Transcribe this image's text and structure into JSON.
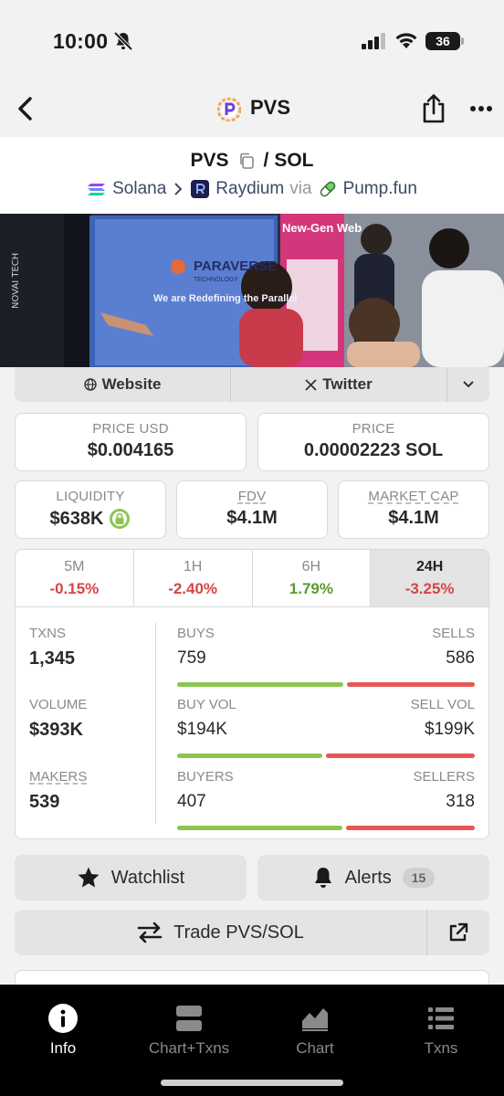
{
  "status_bar": {
    "time": "10:00",
    "battery": "36"
  },
  "nav": {
    "title": "PVS"
  },
  "pair": {
    "base": "PVS",
    "separator": "/",
    "quote": "SOL",
    "chain": "Solana",
    "dex": "Raydium",
    "via": "via",
    "launchpad": "Pump.fun"
  },
  "banner": {
    "brand": "PARAVERSE",
    "brand_sub": "TECHNOLOGY",
    "tagline": "We are Redefining the Parallel",
    "poster_title": "New-Gen Web",
    "side_text": "NOVAI TECH"
  },
  "links": {
    "website": "Website",
    "twitter": "Twitter"
  },
  "prices": {
    "usd_label": "PRICE USD",
    "usd_value": "$0.004165",
    "native_label": "PRICE",
    "native_value": "0.00002223 SOL"
  },
  "metrics": {
    "liquidity_label": "LIQUIDITY",
    "liquidity_value": "$638K",
    "fdv_label": "FDV",
    "fdv_value": "$4.1M",
    "mcap_label": "MARKET CAP",
    "mcap_value": "$4.1M"
  },
  "timeframes": [
    {
      "label": "5M",
      "change": "-0.15%"
    },
    {
      "label": "1H",
      "change": "-2.40%"
    },
    {
      "label": "6H",
      "change": "1.79%"
    },
    {
      "label": "24H",
      "change": "-3.25%"
    }
  ],
  "stats": {
    "txns_label": "TXNS",
    "txns_value": "1,345",
    "volume_label": "VOLUME",
    "volume_value": "$393K",
    "makers_label": "MAKERS",
    "makers_value": "539",
    "buys_label": "BUYS",
    "buys_value": "759",
    "sells_label": "SELLS",
    "sells_value": "586",
    "buys_fraction": 0.564,
    "buyvol_label": "BUY VOL",
    "buyvol_value": "$194K",
    "sellvol_label": "SELL VOL",
    "sellvol_value": "$199K",
    "buyvol_fraction": 0.494,
    "buyers_label": "BUYERS",
    "buyers_value": "407",
    "sellers_label": "SELLERS",
    "sellers_value": "318",
    "buyers_fraction": 0.561
  },
  "actions": {
    "watchlist": "Watchlist",
    "alerts": "Alerts",
    "alerts_count": "15",
    "trade": "Trade PVS/SOL"
  },
  "tabs": [
    {
      "label": "Info"
    },
    {
      "label": "Chart+Txns"
    },
    {
      "label": "Chart"
    },
    {
      "label": "Txns"
    }
  ],
  "colors": {
    "negative": "#d64545",
    "positive": "#5a9a2c",
    "buy_bar": "#8cc54f",
    "sell_bar": "#e85656"
  }
}
